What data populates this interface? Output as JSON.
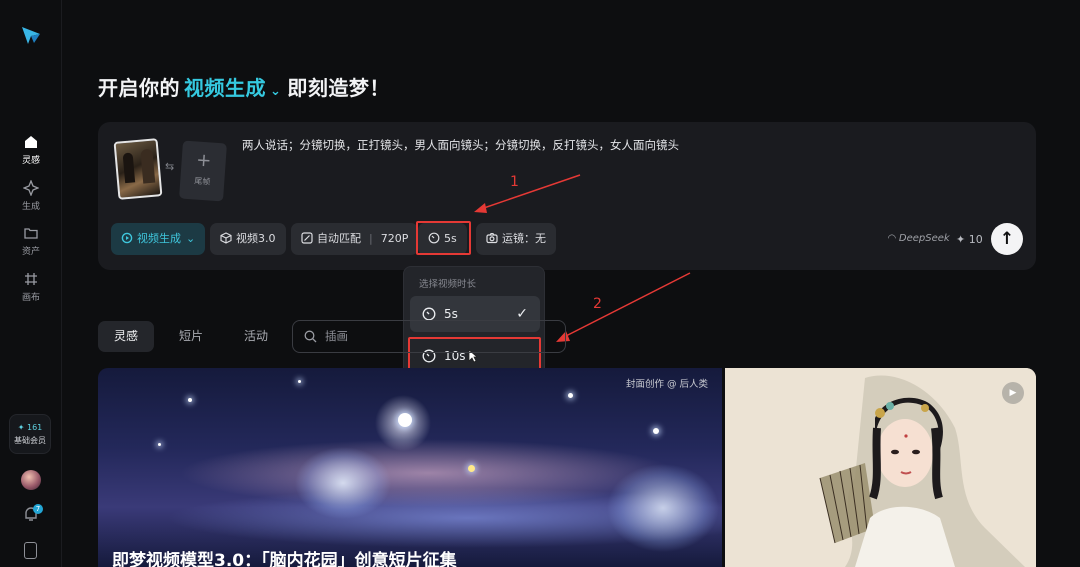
{
  "sidebar": {
    "items": [
      {
        "label": "灵感",
        "icon": "home-icon"
      },
      {
        "label": "生成",
        "icon": "sparkle-icon"
      },
      {
        "label": "资产",
        "icon": "folder-icon"
      },
      {
        "label": "画布",
        "icon": "canvas-icon"
      }
    ],
    "vip_points": "✦ 161",
    "vip_label": "基础会员",
    "notification_count": "7"
  },
  "header": {
    "prefix": "开启你的",
    "mode": "视频生成",
    "suffix": "即刻造梦！"
  },
  "prompt": {
    "text": "两人说话；分镜切换，正打镜头，男人面向镜头；分镜切换，反打镜头，女人面向镜头",
    "end_frame_label": "尾帧"
  },
  "toolbar": {
    "mode_label": "视频生成",
    "model_label": "视频3.0",
    "ratio_label": "自动匹配",
    "resolution_label": "720P",
    "duration_label": "5s",
    "camera_label": "运镜：无",
    "deepseek_label": "DeepSeek",
    "credits_label": "✦ 10"
  },
  "duration_dropdown": {
    "title": "选择视频时长",
    "options": [
      {
        "label": "5s",
        "selected": true
      },
      {
        "label": "10s",
        "selected": false
      }
    ]
  },
  "annotations": {
    "step1": "1",
    "step2": "2",
    "color": "#e53935"
  },
  "feed": {
    "tabs": [
      "灵感",
      "短片",
      "活动"
    ],
    "search_placeholder": "插画",
    "card_a_tag": "封面创作 @ 后人类",
    "card_a_title": "即梦视频模型3.0：「脑内花园」创意短片征集"
  },
  "colors": {
    "accent": "#35c9e0",
    "background": "#0d0e10",
    "card": "#1a1b1f"
  }
}
